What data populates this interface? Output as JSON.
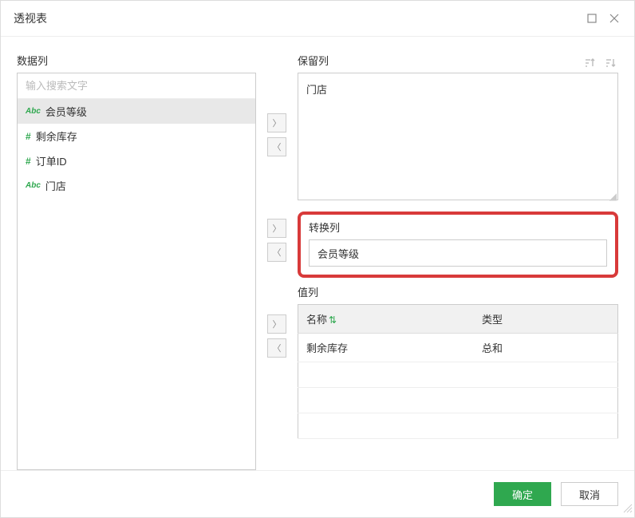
{
  "dialog": {
    "title": "透视表"
  },
  "labels": {
    "dataCol": "数据列",
    "retainCol": "保留列",
    "transformCol": "转换列",
    "valueCol": "值列"
  },
  "search": {
    "placeholder": "输入搜索文字"
  },
  "dataColumns": [
    {
      "type": "abc",
      "name": "会员等级",
      "selected": true
    },
    {
      "type": "hash",
      "name": "剩余库存",
      "selected": false
    },
    {
      "type": "hash",
      "name": "订单ID",
      "selected": false
    },
    {
      "type": "abc",
      "name": "门店",
      "selected": false
    }
  ],
  "retainColumns": [
    "门店"
  ],
  "transformColumns": [
    "会员等级"
  ],
  "valueTable": {
    "headers": {
      "name": "名称",
      "type": "类型"
    },
    "rows": [
      {
        "name": "剩余库存",
        "type": "总和"
      }
    ]
  },
  "buttons": {
    "ok": "确定",
    "cancel": "取消"
  },
  "typeLabels": {
    "abc": "Abc",
    "hash": "#"
  }
}
